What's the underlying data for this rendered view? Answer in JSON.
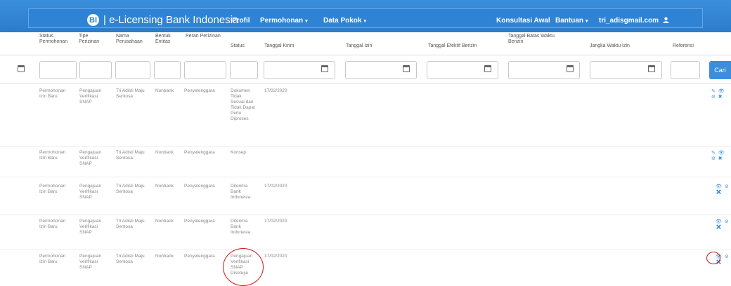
{
  "navbar": {
    "brand": "| e-Licensing Bank Indonesia",
    "logo_text": "BI",
    "menu": [
      {
        "label": "Profil",
        "dropdown": false
      },
      {
        "label": "Permohonan",
        "dropdown": true
      },
      {
        "label": "Data Pokok",
        "dropdown": true
      },
      {
        "label": "Konsultasi Awal",
        "dropdown": false
      },
      {
        "label": "Bantuan",
        "dropdown": true
      },
      {
        "label": "tri_adisgmail.com",
        "dropdown": false
      }
    ],
    "user_icon": "user-icon"
  },
  "table": {
    "columns": [
      "Status Permohonan",
      "Tipe Perizinan",
      "Nama Perusahaan",
      "Bentuk Entitas",
      "Peran Perizinan",
      "Status",
      "Tanggal Kirim",
      "Tanggal Izin",
      "Tanggal Efektif Berizin",
      "Tanggal Batas Waktu Berizin",
      "Jangka Waktu Izin",
      "Referensi"
    ],
    "search_button": "Cari",
    "rows": [
      {
        "status_permohonan": "Permohonan Izin Baru",
        "tipe": "Pengajuan Verifikasi SNAP",
        "nama": "Tri Adisti Maju Sentosa",
        "bentuk": "Nonbank",
        "peran": "Penyelenggara",
        "status": "Dokumen Tidak Sesuai dan Tidak Dapat Perlu Diproses",
        "tanggal_kirim": "17/02/2020",
        "actions": "✎ 👁 ⊘ ✖"
      },
      {
        "status_permohonan": "Permohonan Izin Baru",
        "tipe": "Pengajuan Verifikasi SNAP",
        "nama": "Tri Adisti Maju Sentosa",
        "bentuk": "Nonbank",
        "peran": "Penyelenggara",
        "status": "Konsep",
        "tanggal_kirim": "",
        "actions": "✎ 👁 ⊘ ✖"
      },
      {
        "status_permohonan": "Permohonan Izin Baru",
        "tipe": "Pengajuan Verifikasi SNAP",
        "nama": "Tri Adisti Maju Sentosa",
        "bentuk": "Nonbank",
        "peran": "Penyelenggara",
        "status": "Diterima Bank Indonesia",
        "tanggal_kirim": "17/02/2020",
        "actions": "👁 ⊘ ✖"
      },
      {
        "status_permohonan": "Permohonan Izin Baru",
        "tipe": "Pengajuan Verifikasi SNAP",
        "nama": "Tri Adisti Maju Sentosa",
        "bentuk": "Nonbank",
        "peran": "Penyelenggara",
        "status": "Diterima Bank Indonesia",
        "tanggal_kirim": "17/02/2020",
        "actions": "👁 ⊘ ✖"
      },
      {
        "status_permohonan": "Permohonan Izin Baru",
        "tipe": "Pengajuan Verifikasi SNAP",
        "nama": "Tri Adisti Maju Sentosa",
        "bentuk": "Nonbank",
        "peran": "Penyelenggara",
        "status": "Pengajuan Verifikasi SNAP Disetujui",
        "tanggal_kirim": "17/02/2020",
        "actions": "👁 ⊘ ✖"
      }
    ]
  },
  "colors": {
    "navbar": "#2f83d4",
    "button": "#3b8edb",
    "annotation": "#d01818"
  }
}
